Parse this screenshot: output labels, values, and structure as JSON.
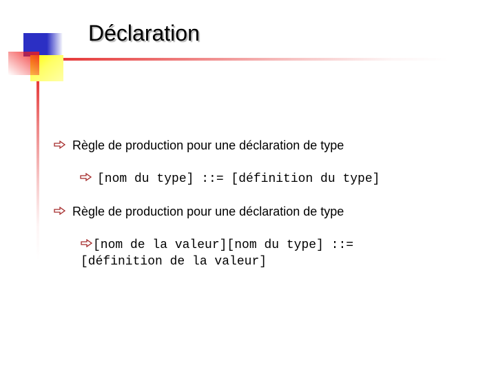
{
  "slide": {
    "title": "Déclaration",
    "accent_colors": {
      "blue": "#2B2FC4",
      "red": "#E53939",
      "yellow": "#FFFF00",
      "bullet_arrow": "#A52A2A"
    },
    "bullet_icon": "outlined-right-arrow-icon",
    "bullets": [
      {
        "text": "Règle de production pour une déclaration de type",
        "sub": "[nom du type] ::= [définition du type]"
      },
      {
        "text": "Règle de production pour une déclaration de type",
        "sub": "[nom de la valeur][nom du type] ::= [définition de la valeur]"
      }
    ]
  }
}
